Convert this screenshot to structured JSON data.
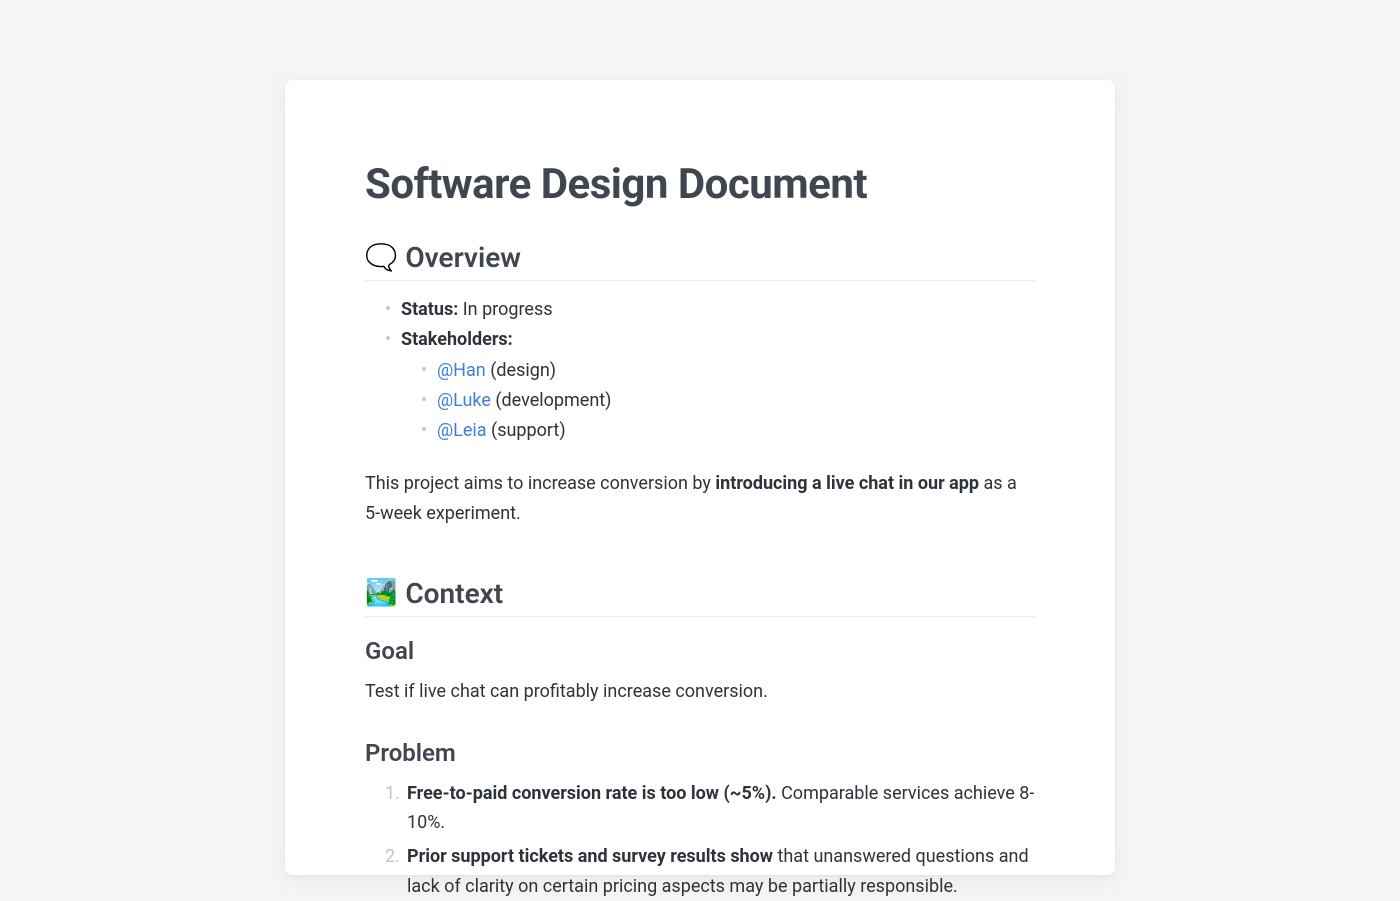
{
  "title": "Software Design Document",
  "sections": {
    "overview": {
      "icon": "🗨️",
      "heading": "Overview",
      "status_label": "Status:",
      "status_value": " In progress",
      "stakeholders_label": "Stakeholders:",
      "stakeholders": [
        {
          "mention": "@Han",
          "role": " (design)"
        },
        {
          "mention": "@Luke",
          "role": " (development)"
        },
        {
          "mention": "@Leia",
          "role": " (support)"
        }
      ],
      "summary_pre": "This project aims to increase conversion by ",
      "summary_bold": "introducing a live chat in our app",
      "summary_post": " as a 5-week experiment."
    },
    "context": {
      "icon": "🏞️",
      "heading": "Context",
      "goal_heading": "Goal",
      "goal_text": "Test if live chat can profitably increase conversion.",
      "problem_heading": "Problem",
      "problems": [
        {
          "bold": "Free-to-paid conversion rate is too low (~5%).",
          "rest": " Comparable services achieve 8-10%."
        },
        {
          "bold": "Prior support tickets and survey results show",
          "rest": " that unanswered questions and lack of clarity on certain pricing aspects may be partially responsible."
        }
      ]
    }
  }
}
